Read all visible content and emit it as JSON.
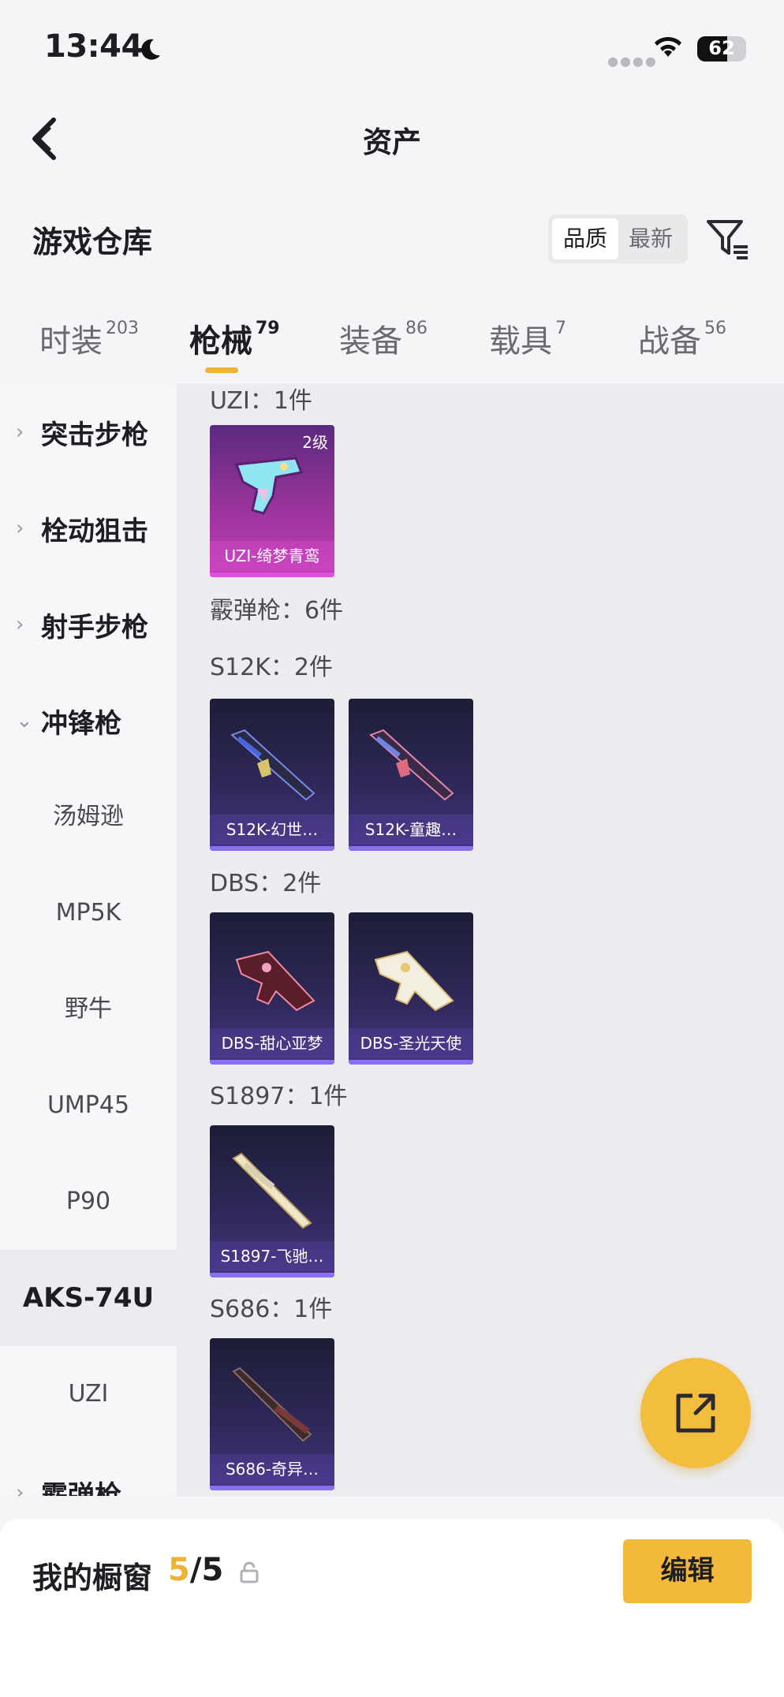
{
  "status_bar": {
    "time": "13:44",
    "battery": "62",
    "battery_level": 0.62
  },
  "header": {
    "title": "资产"
  },
  "warehouse": {
    "title": "游戏仓库",
    "sort_options": [
      "品质",
      "最新"
    ],
    "selected_sort": "品质"
  },
  "tabs": [
    {
      "label": "时装",
      "count": "203"
    },
    {
      "label": "枪械",
      "count": "79",
      "active": true
    },
    {
      "label": "装备",
      "count": "86"
    },
    {
      "label": "载具",
      "count": "7"
    },
    {
      "label": "战备",
      "count": "56"
    }
  ],
  "sidebar": {
    "categories": [
      {
        "label": "突击步枪",
        "expanded": false
      },
      {
        "label": "栓动狙击",
        "expanded": false
      },
      {
        "label": "射手步枪",
        "expanded": false
      },
      {
        "label": "冲锋枪",
        "expanded": true
      },
      {
        "label": "霰弹枪",
        "expanded": false
      }
    ],
    "smg_items": [
      "汤姆逊",
      "MP5K",
      "野牛",
      "UMP45",
      "P90",
      "AKS-74U",
      "UZI"
    ],
    "selected_item": "AKS-74U"
  },
  "content": {
    "groups": [
      {
        "label": "UZI：1件"
      },
      {
        "label": "霰弹枪：6件"
      },
      {
        "label": "S12K：2件"
      },
      {
        "label": "DBS：2件"
      },
      {
        "label": "S1897：1件"
      },
      {
        "label": "S686：1件"
      }
    ],
    "cards": [
      {
        "name": "UZI-绮梦青鸾",
        "level": "2级",
        "rarity": "pink"
      },
      {
        "name": "S12K-幻世…",
        "rarity": "purple"
      },
      {
        "name": "S12K-童趣…",
        "rarity": "purple"
      },
      {
        "name": "DBS-甜心亚梦",
        "rarity": "purple"
      },
      {
        "name": "DBS-圣光天使",
        "rarity": "purple"
      },
      {
        "name": "S1897-飞驰…",
        "rarity": "purple"
      },
      {
        "name": "S686-奇异…",
        "rarity": "purple"
      }
    ]
  },
  "showcase": {
    "label": "我的橱窗",
    "used": "5",
    "total": "/5"
  },
  "actions": {
    "edit_label": "编辑"
  },
  "colors": {
    "accent": "#f0b232",
    "fab": "#f3bd3e",
    "card_purple": "#2e2858",
    "card_pink": "#a0359f"
  },
  "icons": [
    "moon-icon",
    "wifi-icon",
    "battery-icon",
    "back-arrow-icon",
    "filter-icon",
    "chevron-right-icon",
    "chevron-down-icon",
    "share-icon",
    "lock-icon"
  ]
}
